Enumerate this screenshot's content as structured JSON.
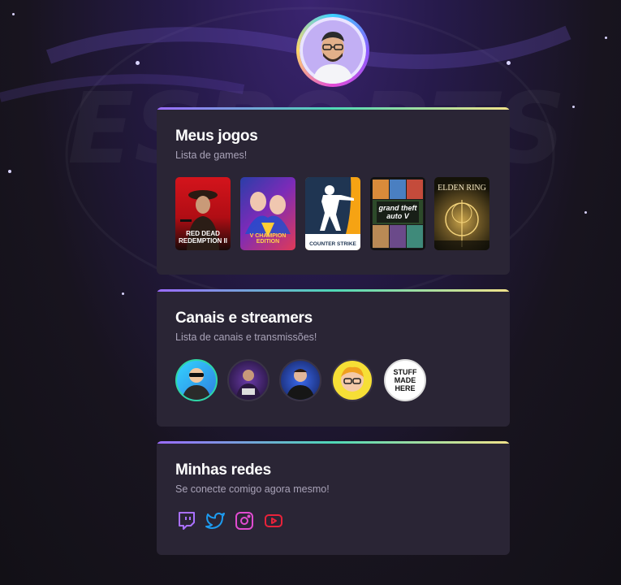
{
  "background": {
    "watermark": "ESPORTS"
  },
  "profile": {
    "avatar_icon": "avatar-icon"
  },
  "games_card": {
    "title": "Meus jogos",
    "subtitle": "Lista de games!",
    "games": [
      {
        "name": "rdr2",
        "label": "RED DEAD REDEMPTION II"
      },
      {
        "name": "street-fighter-v",
        "label": "V CHAMPION EDITION"
      },
      {
        "name": "counter-strike",
        "label": "COUNTER STRIKE"
      },
      {
        "name": "gta-v",
        "label": "grand theft auto V"
      },
      {
        "name": "elden-ring",
        "label": "ELDEN RING"
      }
    ]
  },
  "channels_card": {
    "title": "Canais e streamers",
    "subtitle": "Lista de canais e transmissões!",
    "channels": [
      {
        "name": "channel-1"
      },
      {
        "name": "channel-2"
      },
      {
        "name": "channel-3"
      },
      {
        "name": "channel-4"
      },
      {
        "name": "channel-5",
        "label": "STUFF MADE HERE"
      }
    ]
  },
  "networks_card": {
    "title": "Minhas redes",
    "subtitle": "Se conecte comigo agora mesmo!",
    "networks": [
      {
        "name": "twitch-icon",
        "color": "#a970ff"
      },
      {
        "name": "twitter-icon",
        "color": "#1d9bf0"
      },
      {
        "name": "instagram-icon",
        "color": "#e14bd1"
      },
      {
        "name": "youtube-icon",
        "color": "#e8223a"
      }
    ]
  }
}
